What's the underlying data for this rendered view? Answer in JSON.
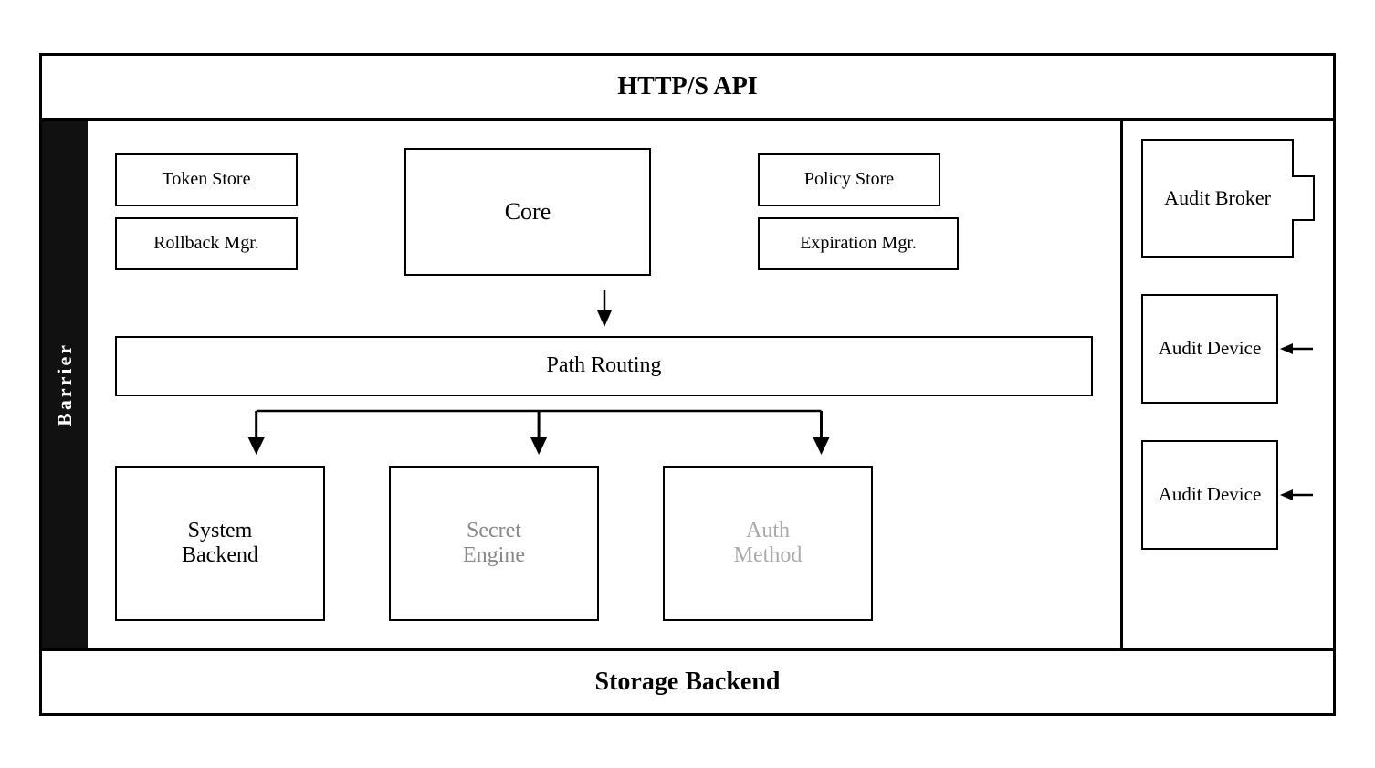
{
  "diagram": {
    "top_bar": "HTTP/S API",
    "bottom_bar": "Storage Backend",
    "barrier_label": "Barrier",
    "boxes": {
      "token_store": "Token Store",
      "rollback_mgr": "Rollback Mgr.",
      "core": "Core",
      "policy_store": "Policy Store",
      "expiration_mgr": "Expiration Mgr.",
      "audit_broker": "Audit Broker",
      "path_routing": "Path Routing",
      "system_backend": "System\nBackend",
      "secret_engine": "Secret\nEngine",
      "auth_method": "Auth\nMethod",
      "audit_device_1": "Audit Device",
      "audit_device_2": "Audit Device"
    }
  }
}
